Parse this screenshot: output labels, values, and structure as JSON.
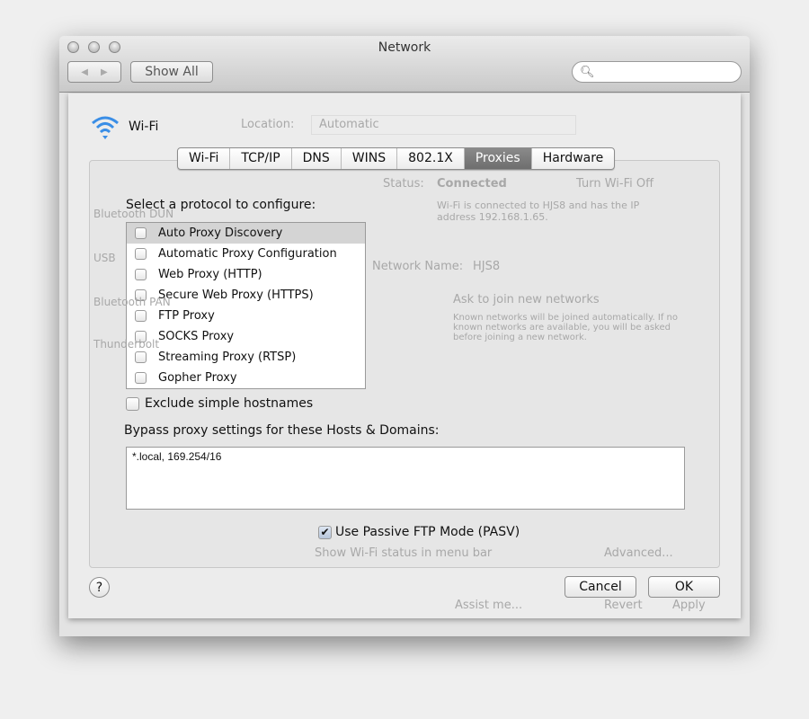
{
  "window": {
    "title": "Network",
    "show_all": "Show All",
    "back_icon": "◀",
    "forward_icon": "▶",
    "search_placeholder": ""
  },
  "background": {
    "location_label": "Location:",
    "location_value": "Automatic",
    "status_label": "Status:",
    "status_value": "Connected",
    "turn_off": "Turn Wi-Fi Off",
    "status_detail": "Wi-Fi is connected to HJS8 and has the IP address 192.168.1.65.",
    "network_name_label": "Network Name:",
    "network_name": "HJS8",
    "ask_join": "Ask to join new networks",
    "ask_join_detail": "Known networks will be joined automatically. If no known networks are available, you will be asked before joining a new network.",
    "show_status": "Show Wi-Fi status in menu bar",
    "advanced": "Advanced...",
    "assist": "Assist me...",
    "revert": "Revert",
    "apply": "Apply",
    "services": [
      "Bluetooth DUN",
      "USB",
      "Bluetooth PAN",
      "Thunderbolt"
    ]
  },
  "sheet": {
    "interface_name": "Wi-Fi",
    "tabs": [
      {
        "label": "Wi-Fi"
      },
      {
        "label": "TCP/IP"
      },
      {
        "label": "DNS"
      },
      {
        "label": "WINS"
      },
      {
        "label": "802.1X"
      },
      {
        "label": "Proxies",
        "selected": true
      },
      {
        "label": "Hardware"
      }
    ],
    "protocol_heading": "Select a protocol to configure:",
    "protocols": [
      {
        "label": "Auto Proxy Discovery",
        "checked": false,
        "selected": true
      },
      {
        "label": "Automatic Proxy Configuration",
        "checked": false
      },
      {
        "label": "Web Proxy (HTTP)",
        "checked": false
      },
      {
        "label": "Secure Web Proxy (HTTPS)",
        "checked": false
      },
      {
        "label": "FTP Proxy",
        "checked": false
      },
      {
        "label": "SOCKS Proxy",
        "checked": false
      },
      {
        "label": "Streaming Proxy (RTSP)",
        "checked": false
      },
      {
        "label": "Gopher Proxy",
        "checked": false
      }
    ],
    "exclude_simple": {
      "label": "Exclude simple hostnames",
      "checked": false
    },
    "bypass_label": "Bypass proxy settings for these Hosts & Domains:",
    "bypass_value": "*.local, 169.254/16",
    "passive_ftp": {
      "label": "Use Passive FTP Mode (PASV)",
      "checked": true,
      "mark": "✔"
    },
    "help": "?",
    "cancel": "Cancel",
    "ok": "OK"
  }
}
